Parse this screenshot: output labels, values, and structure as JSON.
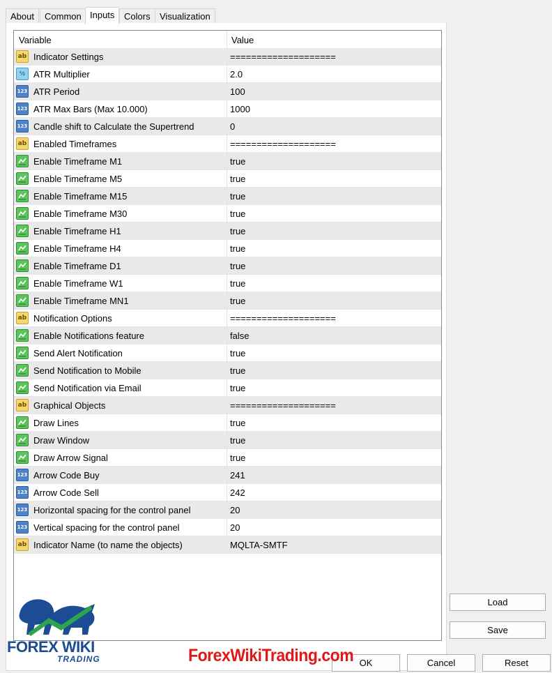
{
  "tabs": [
    {
      "label": "About"
    },
    {
      "label": "Common"
    },
    {
      "label": "Inputs",
      "active": true
    },
    {
      "label": "Colors"
    },
    {
      "label": "Visualization"
    }
  ],
  "grid": {
    "header_variable": "Variable",
    "header_value": "Value",
    "rows": [
      {
        "type": "ab",
        "variable": "Indicator Settings",
        "value": "===================="
      },
      {
        "type": "dbl",
        "variable": "ATR Multiplier",
        "value": "2.0"
      },
      {
        "type": "num",
        "variable": "ATR Period",
        "value": "100"
      },
      {
        "type": "num",
        "variable": "ATR Max Bars (Max 10.000)",
        "value": "1000"
      },
      {
        "type": "num",
        "variable": "Candle shift to Calculate the Supertrend",
        "value": "0"
      },
      {
        "type": "ab",
        "variable": "Enabled Timeframes",
        "value": "===================="
      },
      {
        "type": "bool",
        "variable": "Enable Timeframe M1",
        "value": "true"
      },
      {
        "type": "bool",
        "variable": "Enable Timeframe M5",
        "value": "true"
      },
      {
        "type": "bool",
        "variable": "Enable Timeframe M15",
        "value": "true"
      },
      {
        "type": "bool",
        "variable": "Enable Timeframe M30",
        "value": "true"
      },
      {
        "type": "bool",
        "variable": "Enable Timeframe H1",
        "value": "true"
      },
      {
        "type": "bool",
        "variable": "Enable Timeframe H4",
        "value": "true"
      },
      {
        "type": "bool",
        "variable": "Enable Timeframe D1",
        "value": "true"
      },
      {
        "type": "bool",
        "variable": "Enable Timeframe W1",
        "value": "true"
      },
      {
        "type": "bool",
        "variable": "Enable Timeframe MN1",
        "value": "true"
      },
      {
        "type": "ab",
        "variable": "Notification Options",
        "value": "===================="
      },
      {
        "type": "bool",
        "variable": "Enable Notifications feature",
        "value": "false"
      },
      {
        "type": "bool",
        "variable": "Send Alert Notification",
        "value": "true"
      },
      {
        "type": "bool",
        "variable": "Send Notification to Mobile",
        "value": "true"
      },
      {
        "type": "bool",
        "variable": "Send Notification via Email",
        "value": "true"
      },
      {
        "type": "ab",
        "variable": "Graphical Objects",
        "value": "===================="
      },
      {
        "type": "bool",
        "variable": "Draw Lines",
        "value": "true"
      },
      {
        "type": "bool",
        "variable": "Draw Window",
        "value": "true"
      },
      {
        "type": "bool",
        "variable": "Draw Arrow Signal",
        "value": "true"
      },
      {
        "type": "num",
        "variable": "Arrow Code Buy",
        "value": "241"
      },
      {
        "type": "num",
        "variable": "Arrow Code Sell",
        "value": "242"
      },
      {
        "type": "num",
        "variable": "Horizontal spacing for the control panel",
        "value": "20"
      },
      {
        "type": "num",
        "variable": "Vertical spacing for the control panel",
        "value": "20"
      },
      {
        "type": "ab",
        "variable": "Indicator Name (to name the objects)",
        "value": "MQLTA-SMTF"
      }
    ]
  },
  "icon_glyphs": {
    "ab": "ab",
    "num": "123",
    "dbl": "½",
    "bool": ""
  },
  "buttons": {
    "load": "Load",
    "save": "Save",
    "ok": "OK",
    "cancel": "Cancel",
    "reset": "Reset"
  },
  "watermark": "ForexWikiTrading.com",
  "logo": {
    "brand": "FOREX WIKI",
    "sub": "TRADING"
  },
  "colors": {
    "watermark": "#e01818",
    "logo": "#1c4c94",
    "grid_alt_row": "#e9e9e9"
  }
}
